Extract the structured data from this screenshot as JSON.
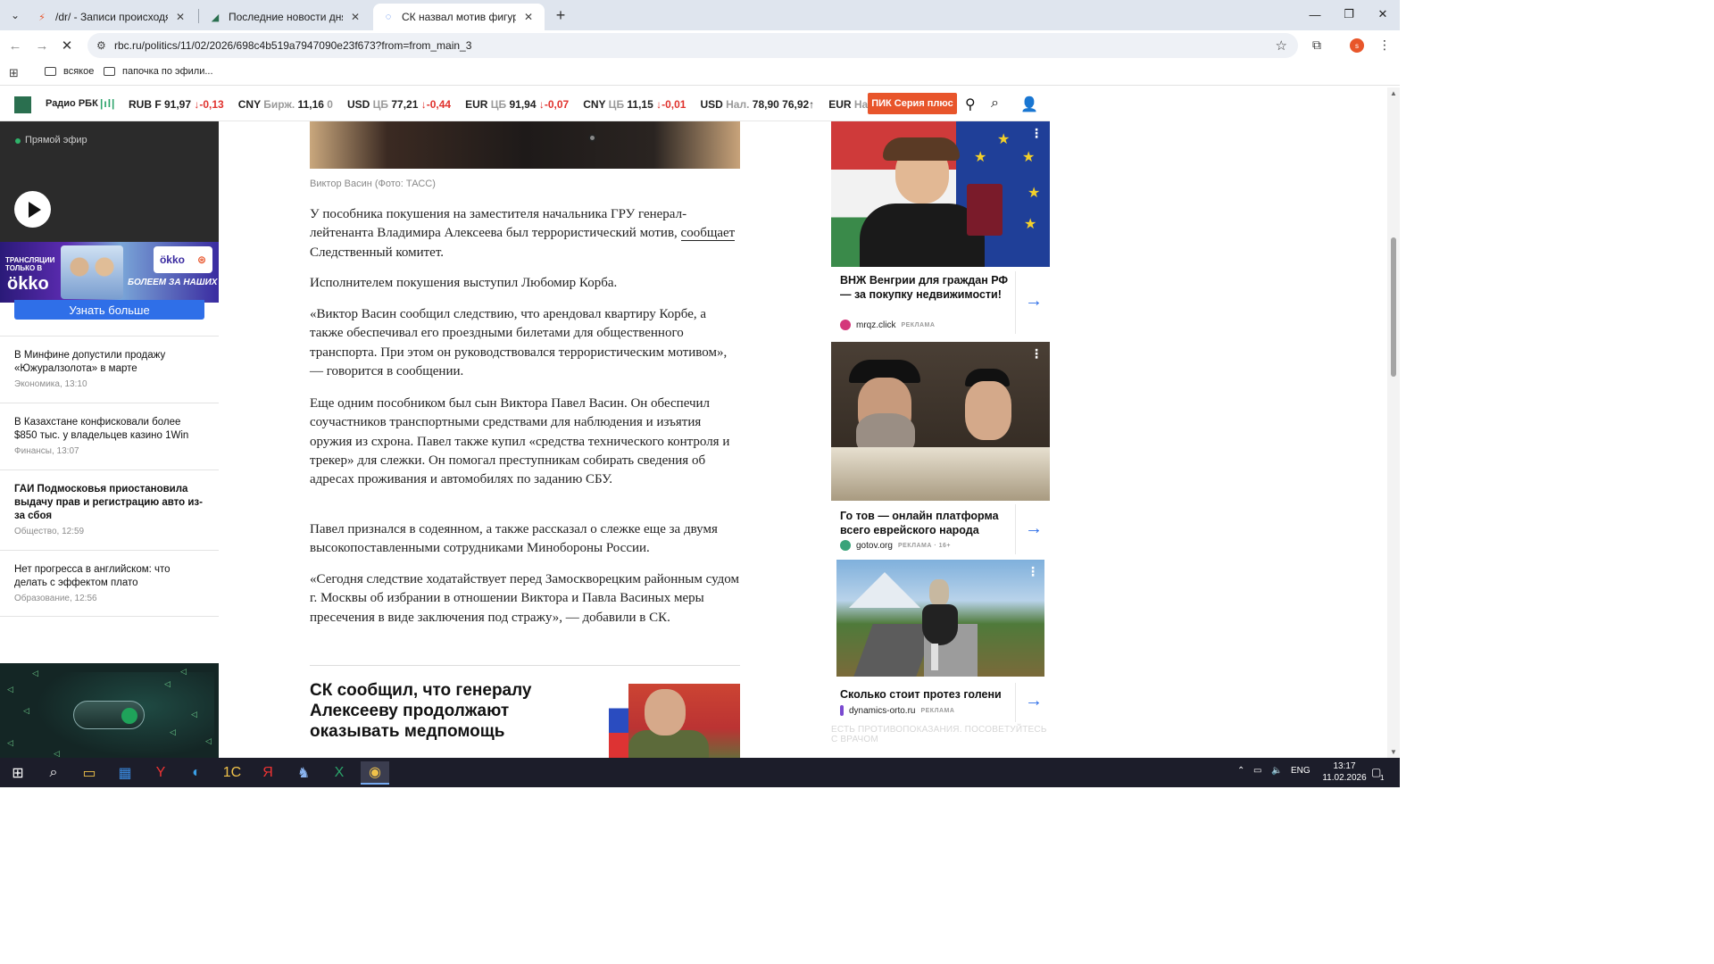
{
  "browser": {
    "tabs": [
      {
        "title": "/dr/ - Записи происходящего",
        "favicon": "lightning-icon",
        "active": false
      },
      {
        "title": "Последние новости дня в Росс",
        "favicon": "rbc-icon",
        "active": false
      },
      {
        "title": "СК назвал мотив фигуранта де",
        "favicon": "loading-icon",
        "active": true
      }
    ],
    "url": "rbc.ru/politics/11/02/2026/698c4b519a7947090e23f673?from=from_main_3",
    "profile_initial": "s",
    "bookmarks": [
      "всякое",
      "папочка по эфили..."
    ]
  },
  "rbc_header": {
    "radio_label": "Радио РБК",
    "tickers": [
      {
        "name": "RUB F",
        "src": "",
        "value": "91,97",
        "dir": "down",
        "change": "-0,13"
      },
      {
        "name": "CNY",
        "src": "Бирж.",
        "value": "11,16",
        "dir": "flat",
        "change": "0"
      },
      {
        "name": "USD",
        "src": "ЦБ",
        "value": "77,21",
        "dir": "down",
        "change": "-0,44"
      },
      {
        "name": "EUR",
        "src": "ЦБ",
        "value": "91,94",
        "dir": "down",
        "change": "-0,07"
      },
      {
        "name": "CNY",
        "src": "ЦБ",
        "value": "11,15",
        "dir": "down",
        "change": "-0,01"
      },
      {
        "name": "USD",
        "src": "Нал.",
        "value": "78,90",
        "dir": "up",
        "change": "76,92"
      },
      {
        "name": "EUR",
        "src": "Нал",
        "value": "",
        "dir": "",
        "change": ""
      }
    ],
    "promo_button": "ПИК Серия плюс"
  },
  "left": {
    "live_label": "Прямой эфир",
    "okko": {
      "left_text": "ТРАНСЛЯЦИИ ТОЛЬКО В",
      "brand": "ökko",
      "badge": "ökko",
      "slogan": "БОЛЕЕМ ЗА НАШИХ"
    },
    "learn_more": "Узнать больше",
    "news": [
      {
        "title": "В Минфине допустили продажу «Южуралзолота» в марте",
        "meta": "Экономика, 13:10",
        "bold": false
      },
      {
        "title": "В Казахстане конфисковали более $850 тыс. у владельцев казино 1Win",
        "meta": "Финансы, 13:07",
        "bold": false
      },
      {
        "title": "ГАИ Подмосковья приостановила выдачу прав и регистрацию авто из-за сбоя",
        "meta": "Общество, 12:59",
        "bold": true
      },
      {
        "title": "Нет прогресса в английском: что делать с эффектом плато",
        "meta": "Образование, 12:56",
        "bold": false
      }
    ]
  },
  "article": {
    "caption": "Виктор Васин (Фото: ТАСС)",
    "p1_before": "У пособника покушения на заместителя начальника ГРУ генерал-лейтенанта Владимира Алексеева был террористический мотив, ",
    "p1_link": "сообщает",
    "p1_after": " Следственный комитет.",
    "p2": "Исполнителем покушения выступил Любомир Корба.",
    "p3": "«Виктор Васин сообщил следствию, что арендовал квартиру Корбе, а также обеспечивал его проездными билетами для общественного транспорта. При этом он руководствовался террористическим мотивом», — говорится в сообщении.",
    "p4": "Еще одним пособником был сын Виктора Павел Васин. Он обеспечил соучастников транспортными средствами для наблюдения и изъятия оружия из схрона. Павел также купил «средства технического контроля и трекер» для слежки. Он помогал преступникам собирать сведения об адресах проживания и автомобилях по заданию СБУ.",
    "p5": "Павел признался в содеянном, а также рассказал о слежке еще за двумя высокопоставленными сотрудниками Минобороны России.",
    "p6": "«Сегодня следствие ходатайствует перед Замоскворецким районным судом г. Москвы об избрании в отношении Виктора и Павла Васиных меры пресечения в виде заключения под стражу», — добавили в СК.",
    "related_title": "СК сообщил, что генералу Алексееву продолжают оказывать медпомощь"
  },
  "ads": [
    {
      "title": "ВНЖ Венгрии для граждан РФ — за покупку недвижимости!",
      "source": "mrqz.click",
      "label": "РЕКЛАМА",
      "dot_color": "#d4367a"
    },
    {
      "title": "Го тов — онлайн платформа всего еврейского народа",
      "source": "gotov.org",
      "label": "РЕКЛАМА · 16+",
      "dot_color": "#3aa37a"
    },
    {
      "title": "Сколько стоит протез голени",
      "source": "dynamics-orto.ru",
      "label": "РЕКЛАМА",
      "dot_color": "#7a4ad0"
    }
  ],
  "ad_warning": "ЕСТЬ ПРОТИВОПОКАЗАНИЯ. ПОСОВЕТУЙТЕСЬ С ВРАЧОМ",
  "taskbar": {
    "lang": "ENG",
    "time": "13:17",
    "date": "11.02.2026",
    "notifications": "1"
  }
}
